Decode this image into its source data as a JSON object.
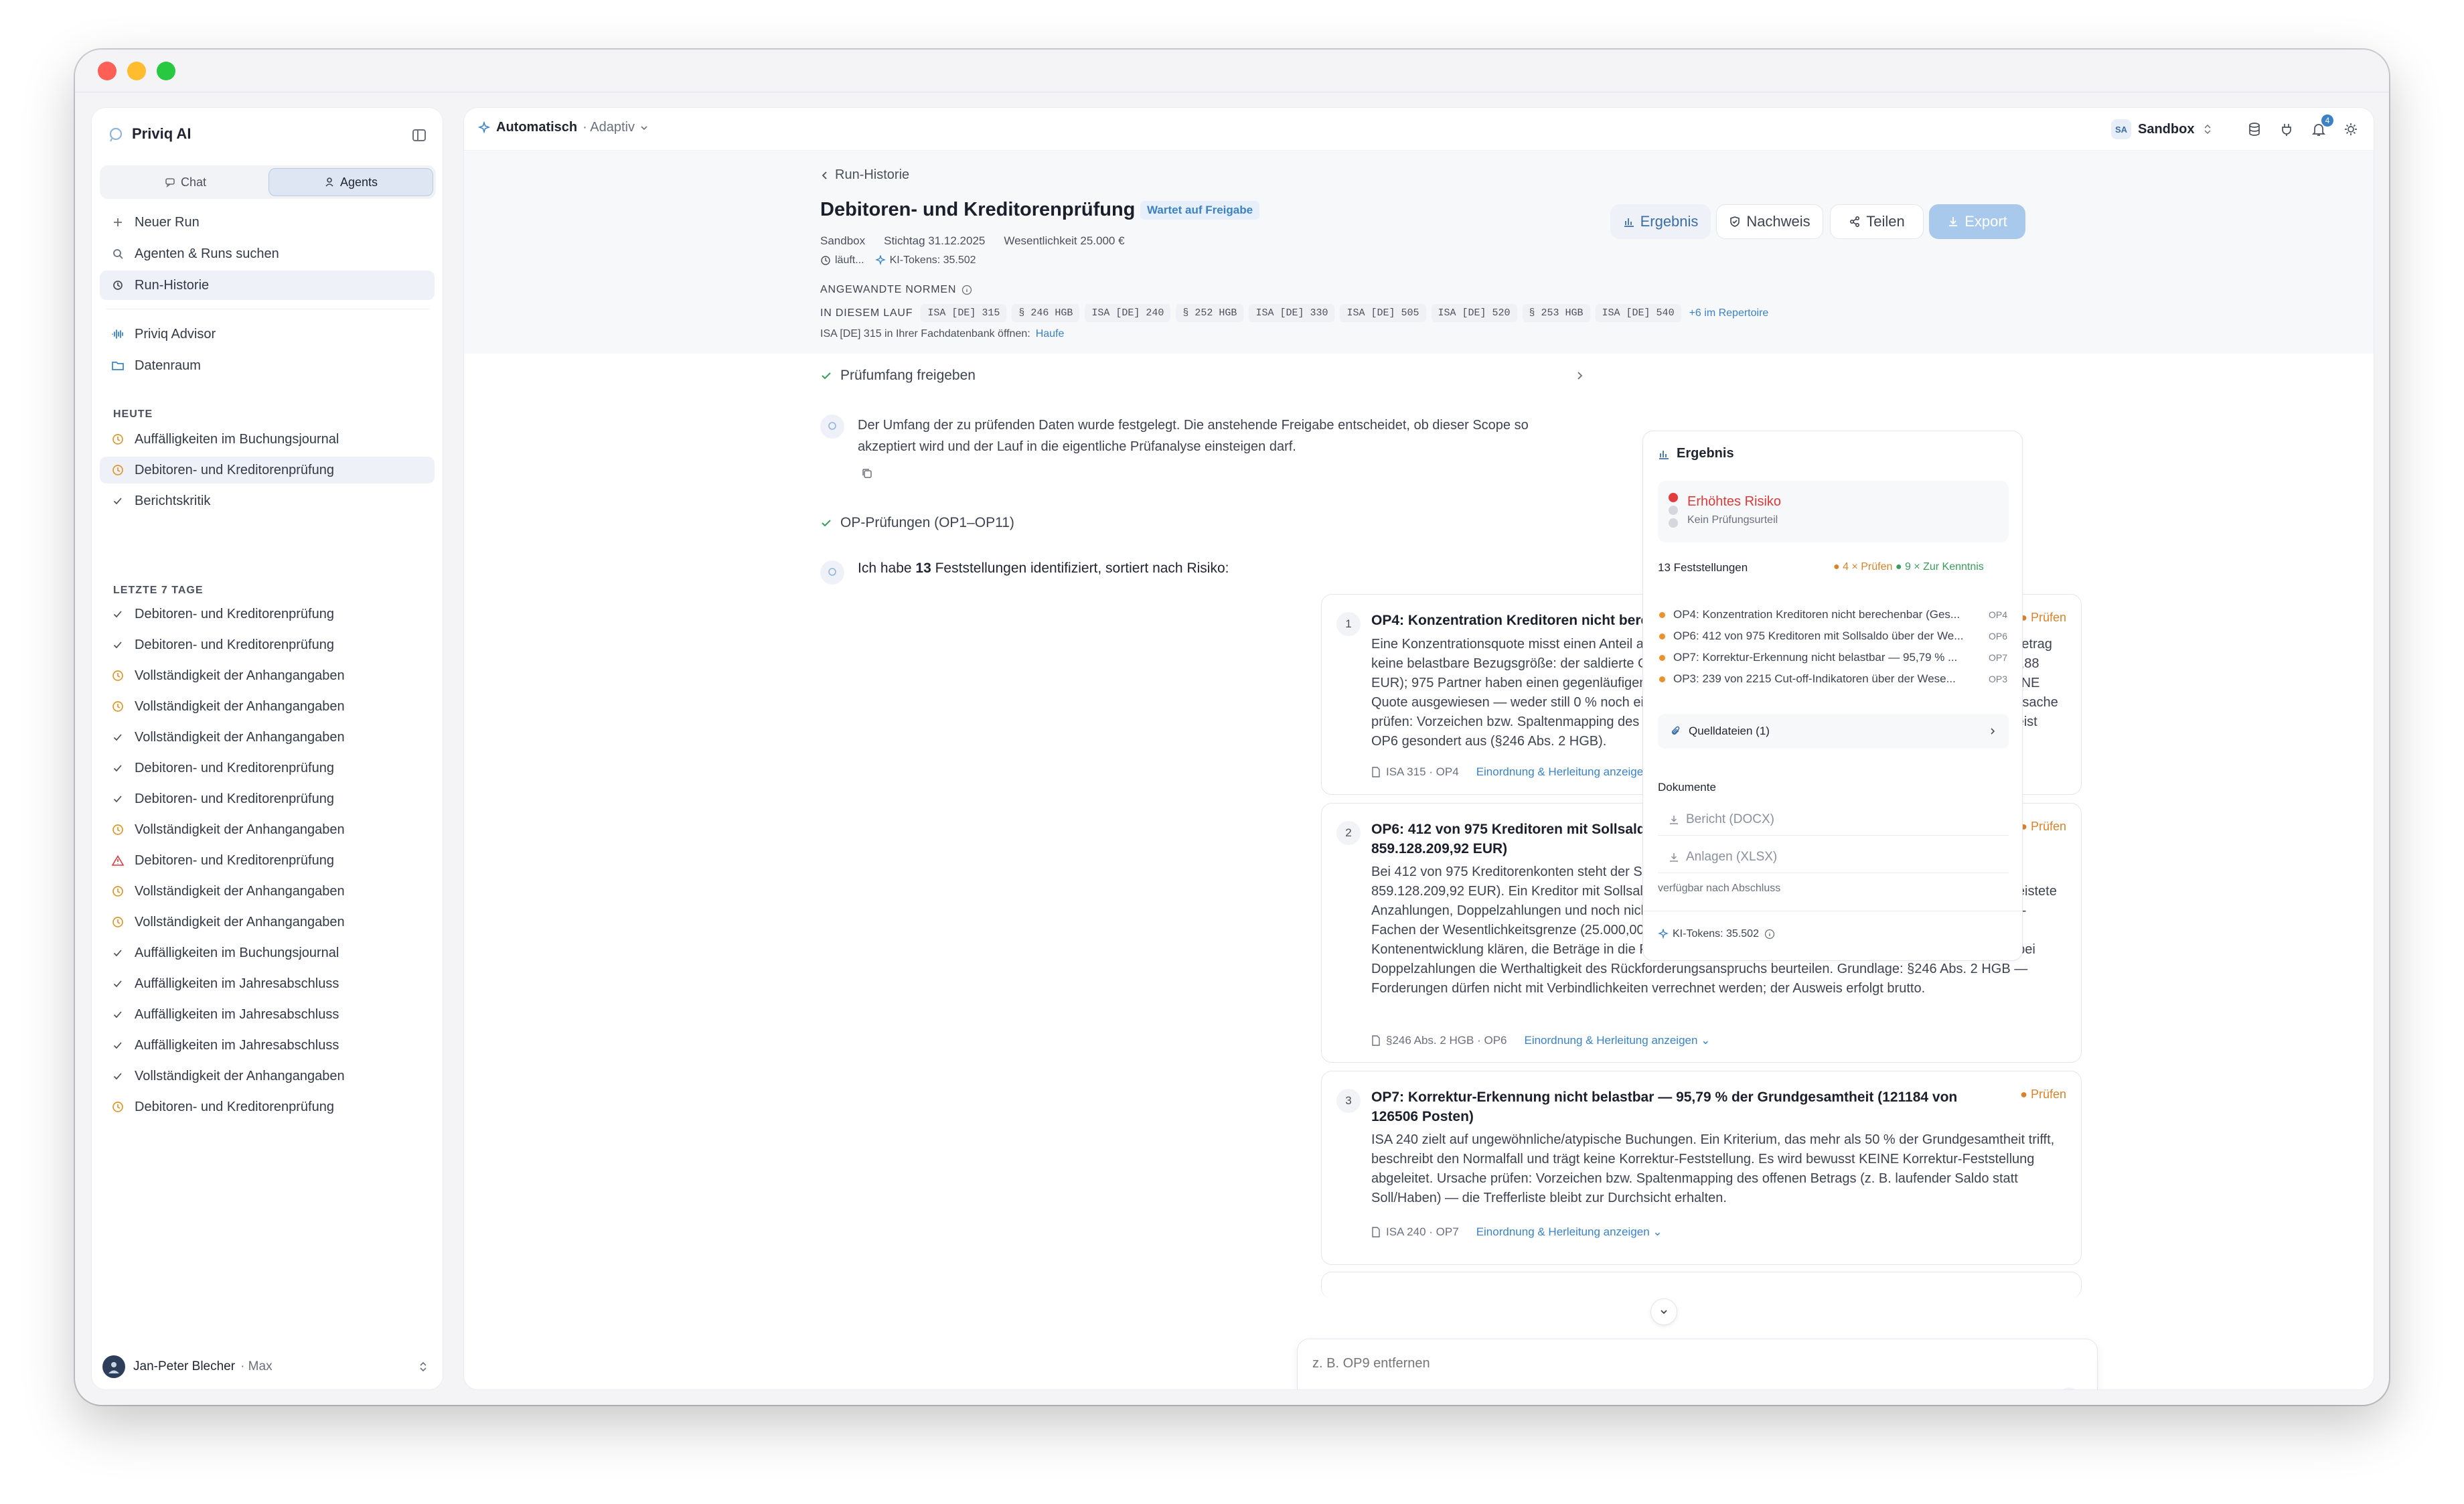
{
  "app": {
    "name": "Priviq AI"
  },
  "sidebar": {
    "tabs": [
      {
        "label": "Chat"
      },
      {
        "label": "Agents"
      }
    ],
    "actions": [
      {
        "label": "Neuer Run"
      },
      {
        "label": "Agenten & Runs suchen"
      },
      {
        "label": "Run-Historie"
      }
    ],
    "links": [
      {
        "label": "Priviq Advisor"
      },
      {
        "label": "Datenraum"
      }
    ],
    "today_label": "HEUTE",
    "today": [
      {
        "label": "Auffälligkeiten im Buchungsjournal",
        "status": "pending"
      },
      {
        "label": "Debitoren- und Kreditorenprüfung",
        "status": "pending"
      },
      {
        "label": "Berichtskritik",
        "status": "done"
      }
    ],
    "week_label": "LETZTE 7 TAGE",
    "week": [
      {
        "label": "Debitoren- und Kreditorenprüfung",
        "status": "done"
      },
      {
        "label": "Debitoren- und Kreditorenprüfung",
        "status": "done"
      },
      {
        "label": "Vollständigkeit der Anhangangaben",
        "status": "pending"
      },
      {
        "label": "Vollständigkeit der Anhangangaben",
        "status": "pending"
      },
      {
        "label": "Vollständigkeit der Anhangangaben",
        "status": "done"
      },
      {
        "label": "Debitoren- und Kreditorenprüfung",
        "status": "done"
      },
      {
        "label": "Debitoren- und Kreditorenprüfung",
        "status": "done"
      },
      {
        "label": "Vollständigkeit der Anhangangaben",
        "status": "pending"
      },
      {
        "label": "Debitoren- und Kreditorenprüfung",
        "status": "warning"
      },
      {
        "label": "Vollständigkeit der Anhangangaben",
        "status": "pending"
      },
      {
        "label": "Vollständigkeit der Anhangangaben",
        "status": "pending"
      },
      {
        "label": "Auffälligkeiten im Buchungsjournal",
        "status": "done"
      },
      {
        "label": "Auffälligkeiten im Jahresabschluss",
        "status": "done"
      },
      {
        "label": "Auffälligkeiten im Jahresabschluss",
        "status": "done"
      },
      {
        "label": "Auffälligkeiten im Jahresabschluss",
        "status": "done"
      },
      {
        "label": "Vollständigkeit der Anhangangaben",
        "status": "done"
      },
      {
        "label": "Debitoren- und Kreditorenprüfung",
        "status": "pending"
      }
    ],
    "user": {
      "name": "Jan-Peter Blecher",
      "plan": "· Max"
    }
  },
  "topbar": {
    "mode": "Automatisch",
    "mode_sub": "· Adaptiv",
    "workspace_initials": "SA",
    "workspace": "Sandbox",
    "notifications": "4"
  },
  "run": {
    "breadcrumb": "Run-Historie",
    "title": "Debitoren- und Kreditorenprüfung",
    "status": "Wartet auf Freigabe",
    "meta": [
      "Sandbox",
      "Stichtag 31.12.2025",
      "Wesentlichkeit 25.000 €"
    ],
    "running": "läuft...",
    "tokens": "KI-Tokens: 35.502",
    "norms_label": "ANGEWANDTE NORMEN",
    "in_run_label": "IN DIESEM LAUF",
    "norms": [
      "ISA [DE] 315",
      "§ 246 HGB",
      "ISA [DE] 240",
      "§ 252 HGB",
      "ISA [DE] 330",
      "ISA [DE] 505",
      "ISA [DE] 520",
      "§ 253 HGB",
      "ISA [DE] 540"
    ],
    "norms_more": "+6 im Repertoire",
    "db_hint": "ISA [DE] 315 in Ihrer Fachdatenbank öffnen:",
    "db_link": "Haufe",
    "actions": {
      "result": "Ergebnis",
      "proof": "Nachweis",
      "share": "Teilen",
      "export": "Export"
    }
  },
  "conversation": {
    "step1": "Prüfumfang freigeben",
    "msg1": "Der Umfang der zu prüfenden Daten wurde festgelegt. Die anstehende Freigabe entscheidet, ob dieser Scope so akzeptiert wird und der Lauf in die eigentliche Prüfanalyse einsteigen darf.",
    "step2": "OP-Prüfungen (OP1–OP11)",
    "msg2_pre": "Ich habe ",
    "msg2_count": "13",
    "msg2_post": " Feststellungen identifiziert, sortiert nach Risiko:",
    "findings": [
      {
        "num": "1",
        "title": "OP4: Konzentration Kreditoren nicht berechenbar (Gesamtbetrag -862.457.719,88 EUR)",
        "badge": "Prüfen",
        "body": "Eine Konzentrationsquote misst einen Anteil am saldierten Gesamtbetrag der offenen Posten; hier ist dieser Betrag keine belastbare Bezugsgröße: der saldierte Gesamtbetrag der offenen Posten ist nicht positiv (−862.457.719,88 EUR); 975 Partner haben einen gegenläufigen Saldo (zusammen 862.458.508,93 EUR). Es wird bewusst KEINE Quote ausgewiesen — weder still 0 % noch ein Anteil über 100 %, der ein Teil des Ganzen nicht sein kann. Ursache prüfen: Vorzeichen bzw. Spaltenmapping des offenen Betrags; Konten mit insgesamt gegenläufigem Saldo weist OP6 gesondert aus (§246 Abs. 2 HGB).",
        "ref": "ISA 315 · OP4",
        "link": "Einordnung & Herleitung anzeigen ⌄"
      },
      {
        "num": "2",
        "title": "OP6: 412 von 975 Kreditoren mit Sollsaldo über der Wesentlichkeitsgrenze (Summe 859.128.209,92 EUR)",
        "badge": "Prüfen",
        "body": "Bei 412 von 975 Kreditorenkonten steht der Saldo nach Verrechnung aller Posten des Kontos im Soll (Summe 859.128.209,92 EUR). Ein Kreditor mit Sollsaldo ist wirtschaftlich eine Forderung; typische Ursachen sind geleistete Anzahlungen, Doppelzahlungen und noch nicht verrechnete Gutschriften. Der Betrag entspricht dem 34.365,1-Fachen der Wesentlichkeitsgrenze (25.000,00 EUR). Prüfungshandlung: Ursache je Konto anhand der Kontenentwicklung klären, die Beträge in die Forderungen bzw. die geleisteten Anzahlungen umgliedern und bei Doppelzahlungen die Werthaltigkeit des Rückforderungsanspruchs beurteilen. Grundlage: §246 Abs. 2 HGB — Forderungen dürfen nicht mit Verbindlichkeiten verrechnet werden; der Ausweis erfolgt brutto.",
        "ref": "§246 Abs. 2 HGB · OP6",
        "link": "Einordnung & Herleitung anzeigen ⌄"
      },
      {
        "num": "3",
        "title": "OP7: Korrektur-Erkennung nicht belastbar — 95,79 % der Grundgesamtheit (121184 von 126506 Posten)",
        "badge": "Prüfen",
        "body": "ISA 240 zielt auf ungewöhnliche/atypische Buchungen. Ein Kriterium, das mehr als 50 % der Grundgesamtheit trifft, beschreibt den Normalfall und trägt keine Korrektur-Feststellung. Es wird bewusst KEINE Korrektur-Feststellung abgeleitet. Ursache prüfen: Vorzeichen bzw. Spaltenmapping des offenen Betrags (z. B. laufender Saldo statt Soll/Haben) — die Trefferliste bleibt zur Durchsicht erhalten.",
        "ref": "ISA 240 · OP7",
        "link": "Einordnung & Herleitung anzeigen ⌄"
      }
    ],
    "input_placeholder": "z. B. OP9 entfernen"
  },
  "result_panel": {
    "title": "Ergebnis",
    "risk": "Erhöhtes Risiko",
    "risk_sub": "Kein Prüfungsurteil",
    "count": "13 Feststellungen",
    "check_count": "4 × Prüfen",
    "note_count": "9 × Zur Kenntnis",
    "items": [
      {
        "text": "OP4: Konzentration Kreditoren nicht berechenbar (Ges...",
        "code": "OP4"
      },
      {
        "text": "OP6: 412 von 975 Kreditoren mit Sollsaldo über der We...",
        "code": "OP6"
      },
      {
        "text": "OP7: Korrektur-Erkennung nicht belastbar — 95,79 % ...",
        "code": "OP7"
      },
      {
        "text": "OP3: 239 von 2215 Cut-off-Indikatoren über der Wese...",
        "code": "OP3"
      }
    ],
    "sources": "Quelldateien (1)",
    "docs_label": "Dokumente",
    "docs": [
      {
        "label": "Bericht (DOCX)"
      },
      {
        "label": "Anlagen (XLSX)"
      }
    ],
    "docs_hint": "verfügbar nach Abschluss",
    "tokens": "KI-Tokens: 35.502"
  },
  "colors": {
    "accent": "#3b82c4",
    "warning": "#d9822b",
    "success": "#3a9b5a",
    "danger": "#d93a3a"
  }
}
